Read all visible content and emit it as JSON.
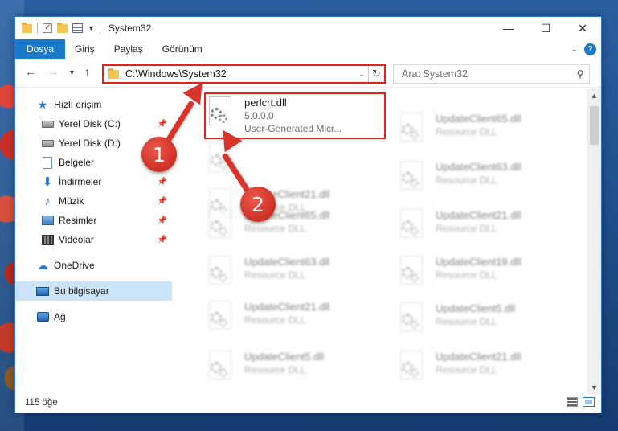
{
  "window": {
    "title": "System32",
    "controls": {
      "minimize": "—",
      "maximize": "☐",
      "close": "✕"
    }
  },
  "ribbon": {
    "tabs": [
      "Dosya",
      "Giriş",
      "Paylaş",
      "Görünüm"
    ],
    "help": "?"
  },
  "navbar": {
    "address": "C:\\Windows\\System32",
    "search_placeholder": "Ara: System32"
  },
  "sidebar": {
    "items": [
      {
        "label": "Hızlı erişim",
        "icon": "star-icon"
      },
      {
        "label": "Yerel Disk (C:)",
        "icon": "drive-icon",
        "pinned": true
      },
      {
        "label": "Yerel Disk (D:)",
        "icon": "drive-icon"
      },
      {
        "label": "Belgeler",
        "icon": "documents-icon"
      },
      {
        "label": "İndirmeler",
        "icon": "downloads-icon",
        "pinned": true
      },
      {
        "label": "Müzik",
        "icon": "music-icon",
        "pinned": true
      },
      {
        "label": "Resimler",
        "icon": "pictures-icon",
        "pinned": true
      },
      {
        "label": "Videolar",
        "icon": "videos-icon",
        "pinned": true
      },
      {
        "label": "OneDrive",
        "icon": "onedrive-icon"
      },
      {
        "label": "Bu bilgisayar",
        "icon": "this-pc-icon",
        "selected": true
      },
      {
        "label": "Ağ",
        "icon": "network-icon"
      }
    ]
  },
  "files": {
    "highlighted": {
      "name": "perlcrt.dll",
      "version": "5.0.0.0",
      "company": "User-Generated Micr..."
    },
    "left_column": [
      {
        "name": "",
        "type": ""
      },
      {
        "name": "UpdateClient21.dll",
        "type": "Resource DLL"
      },
      {
        "name": "UpdateClient65.dll",
        "type": "Resource DLL"
      },
      {
        "name": "UpdateClient63.dll",
        "type": "Resource DLL"
      },
      {
        "name": "UpdateClient21.dll",
        "type": "Resource DLL"
      },
      {
        "name": "UpdateClient5.dll",
        "type": "Resource DLL"
      }
    ],
    "right_column": [
      {
        "name": "UpdateClient65.dll",
        "type": "Resource DLL"
      },
      {
        "name": "UpdateClient63.dll",
        "type": "Resource DLL"
      },
      {
        "name": "UpdateClient21.dll",
        "type": "Resource DLL"
      },
      {
        "name": "UpdateClient19.dll",
        "type": "Resource DLL"
      },
      {
        "name": "UpdateClient5.dll",
        "type": "Resource DLL"
      },
      {
        "name": "UpdateClient21.dll",
        "type": "Resource DLL"
      }
    ]
  },
  "status": {
    "count": "115 öğe"
  },
  "callouts": {
    "one": "1",
    "two": "2"
  },
  "colors": {
    "accent": "#1979ca",
    "highlight": "#e8201a",
    "callout": "#d9342b"
  }
}
